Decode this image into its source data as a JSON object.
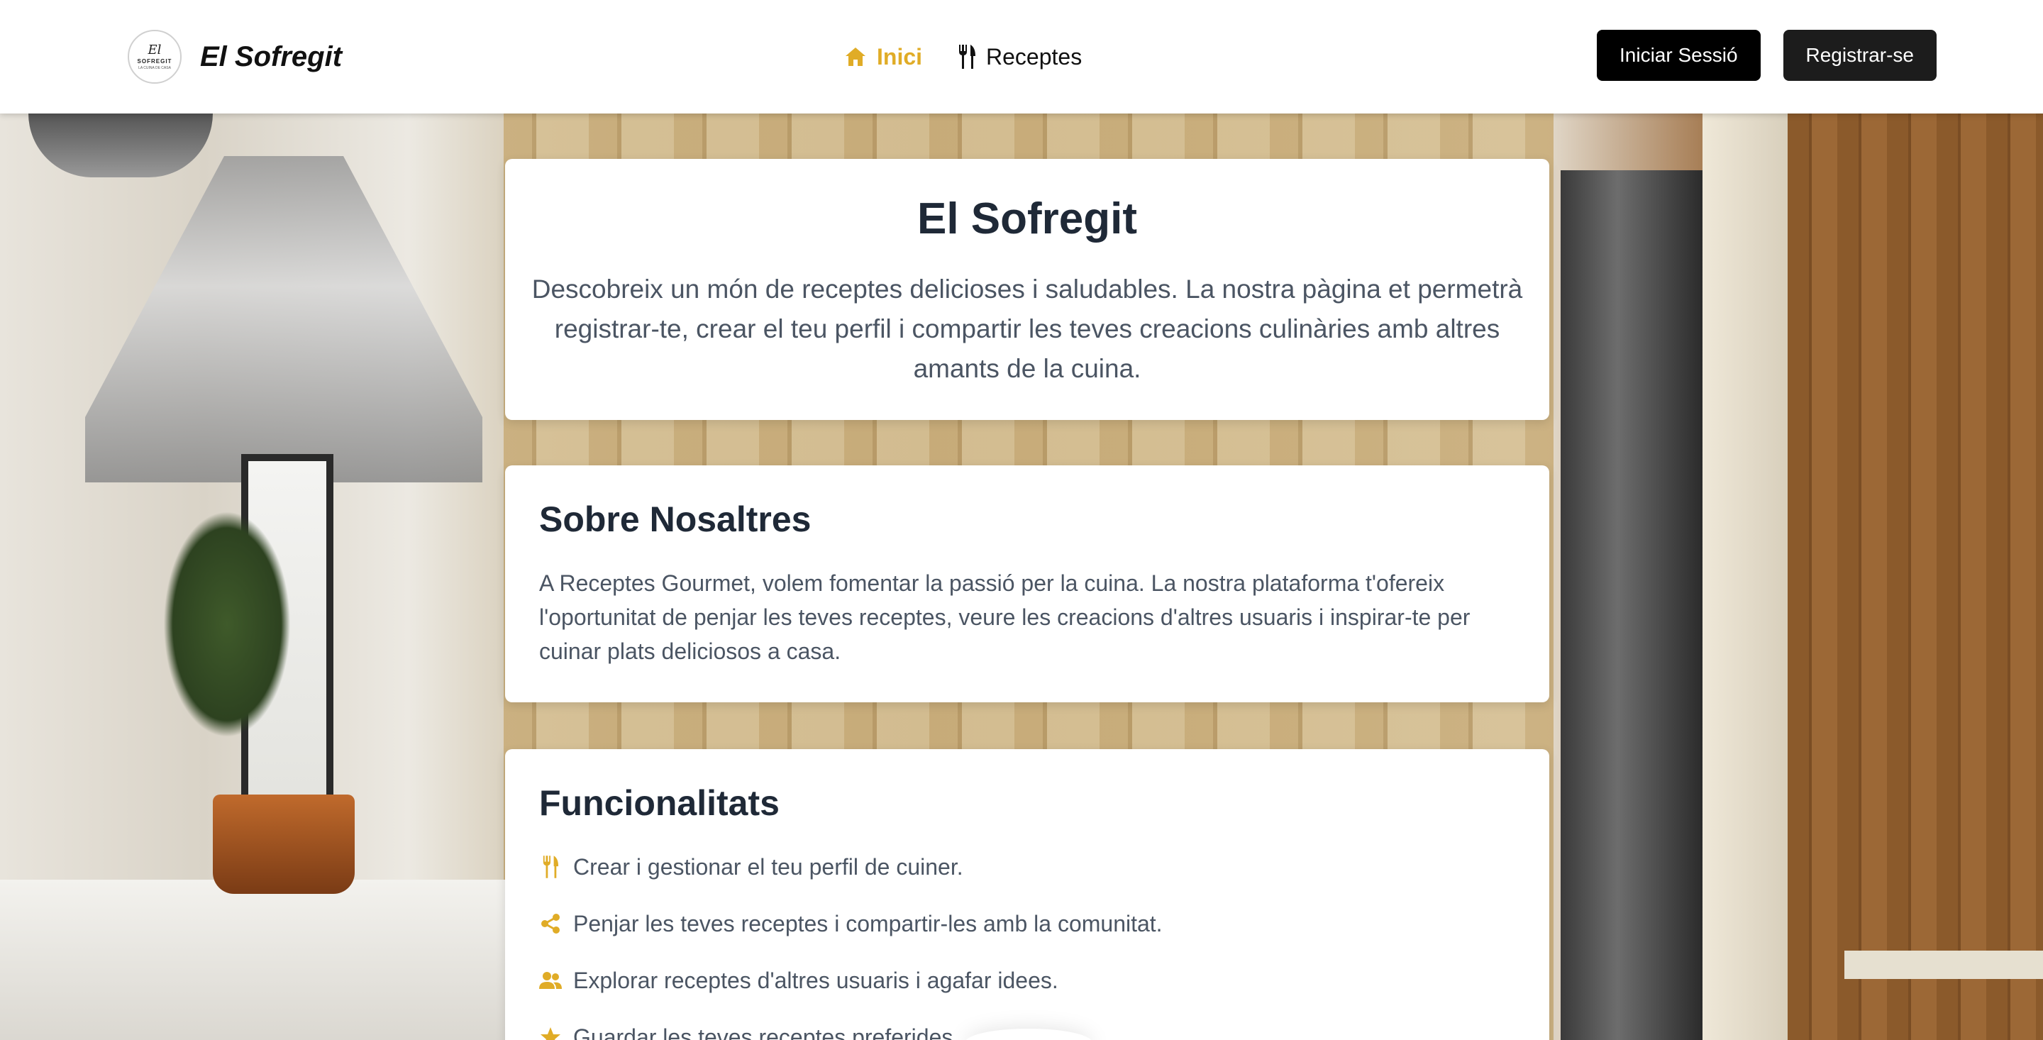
{
  "header": {
    "logo_lines": [
      "El",
      "SOFREGIT",
      "LA CUINA DE CASA"
    ],
    "brand_name": "El Sofregit",
    "nav": [
      {
        "label": "Inici",
        "icon": "home-icon",
        "active": true
      },
      {
        "label": "Receptes",
        "icon": "utensils-icon",
        "active": false
      }
    ],
    "login_label": "Iniciar Sessió",
    "register_label": "Registrar-se"
  },
  "hero": {
    "title": "El Sofregit",
    "description": "Descobreix un món de receptes delicioses i saludables. La nostra pàgina et permetrà registrar-te, crear el teu perfil i compartir les teves creacions culinàries amb altres amants de la cuina."
  },
  "about": {
    "title": "Sobre Nosaltres",
    "text": "A Receptes Gourmet, volem fomentar la passió per la cuina. La nostra plataforma t'ofereix l'oportunitat de penjar les teves receptes, veure les creacions d'altres usuaris i inspirar-te per cuinar plats deliciosos a casa."
  },
  "features": {
    "title": "Funcionalitats",
    "items": [
      {
        "icon": "utensils-icon",
        "text": "Crear i gestionar el teu perfil de cuiner."
      },
      {
        "icon": "share-icon",
        "text": "Penjar les teves receptes i compartir-les amb la comunitat."
      },
      {
        "icon": "users-icon",
        "text": "Explorar receptes d'altres usuaris i agafar idees."
      },
      {
        "icon": "star-icon",
        "text": "Guardar les teves receptes preferides."
      }
    ]
  },
  "colors": {
    "accent": "#e0ac27",
    "heading": "#1f2937",
    "body_text": "#4b5563",
    "button_bg": "#000000"
  }
}
